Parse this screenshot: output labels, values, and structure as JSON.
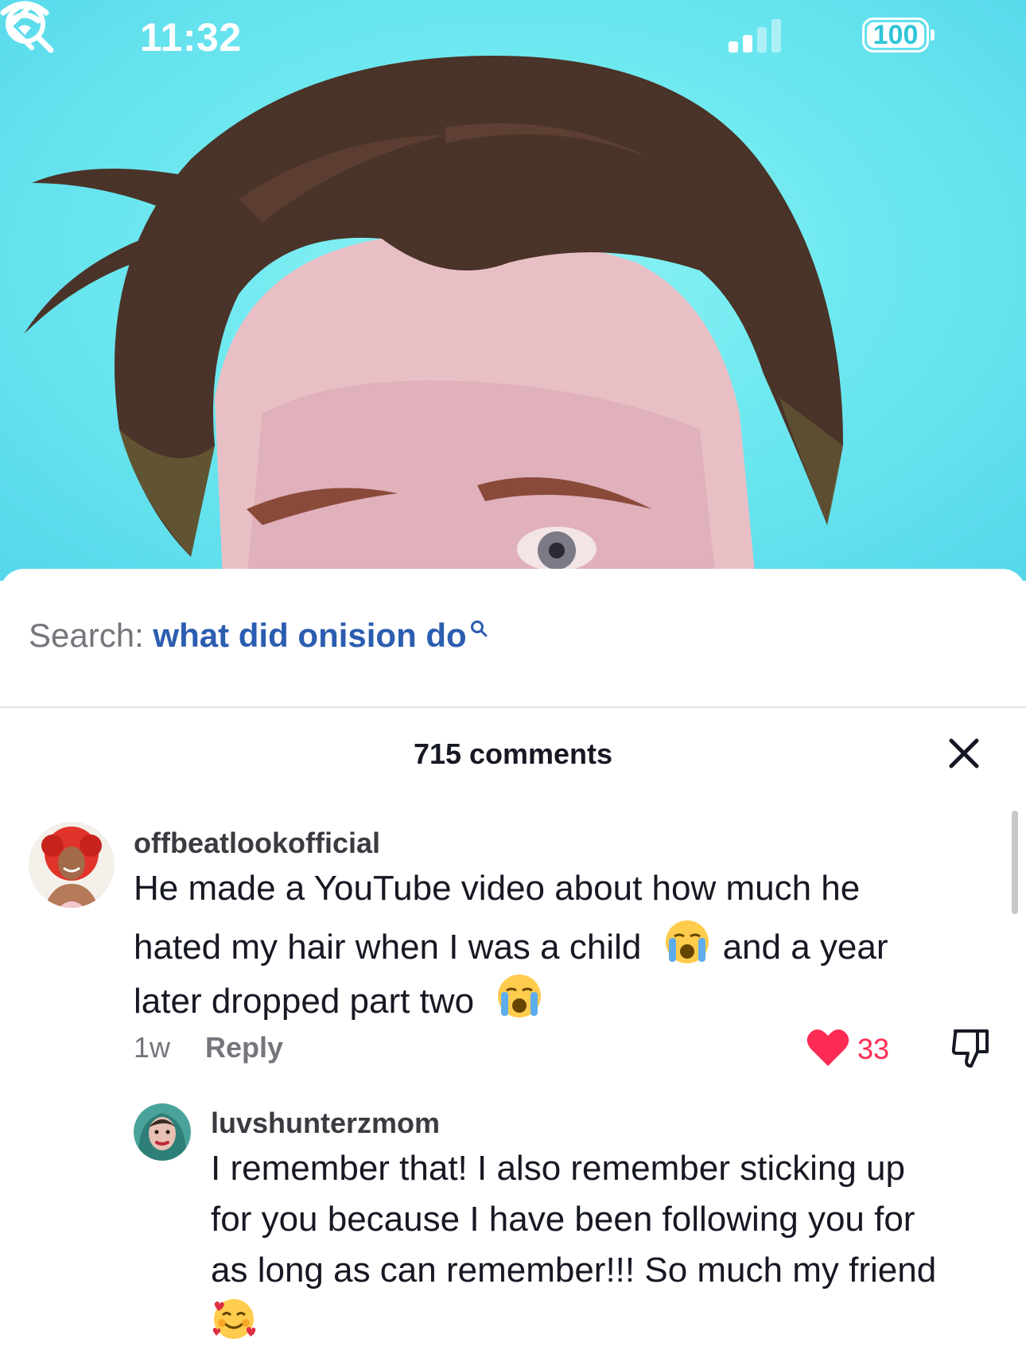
{
  "status_bar": {
    "time": "11:32",
    "battery": "100"
  },
  "search": {
    "prefix": "Search:",
    "query": "what did onision do"
  },
  "comments_header": {
    "count_label": "715 comments"
  },
  "comments": [
    {
      "username": "offbeatlookofficial",
      "lines": [
        "He made a YouTube video about how much he",
        "hated my hair when I was a child",
        "and a year",
        "later dropped part two"
      ],
      "time": "1w",
      "reply_label": "Reply",
      "likes": "33"
    },
    {
      "username": "luvshunterzmom",
      "lines": [
        "I remember that! I also remember sticking up",
        "for you because I have been following you for",
        "as long as can remember!!! So much my friend"
      ]
    }
  ],
  "icons": {
    "back": "chevron-left-icon",
    "search": "search-icon",
    "close": "close-icon",
    "like": "heart-icon",
    "dislike": "thumbs-down-icon",
    "crying_emoji": "loudly-crying-face",
    "smiling_hearts_emoji": "smiling-face-with-hearts"
  },
  "colors": {
    "query_link": "#2b5db0",
    "like_red": "#fe2c55",
    "video_bg": "#6fe9f0"
  }
}
